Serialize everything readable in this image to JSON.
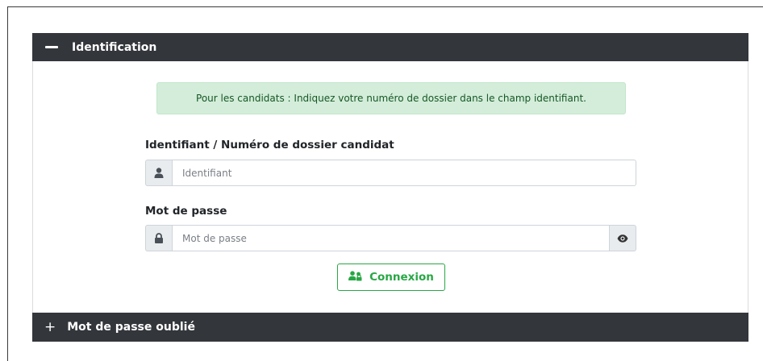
{
  "identification": {
    "title": "Identification",
    "alert": "Pour les candidats : Indiquez votre numéro de dossier dans le champ identifiant.",
    "username_label": "Identifiant / Numéro de dossier candidat",
    "username_placeholder": "Identifiant",
    "username_value": "",
    "password_label": "Mot de passe",
    "password_placeholder": "Mot de passe",
    "password_value": "",
    "login_button": "Connexion"
  },
  "forgot_password": {
    "title": "Mot de passe oublié"
  },
  "icons": {
    "collapse": "minus-icon",
    "expand": "plus-icon",
    "user": "user-icon",
    "lock": "lock-icon",
    "show_password": "eye-icon",
    "login": "users-icon"
  },
  "colors": {
    "header_bg": "#33363b",
    "alert_bg": "#d4edda",
    "alert_text": "#155724",
    "success": "#28a745"
  }
}
